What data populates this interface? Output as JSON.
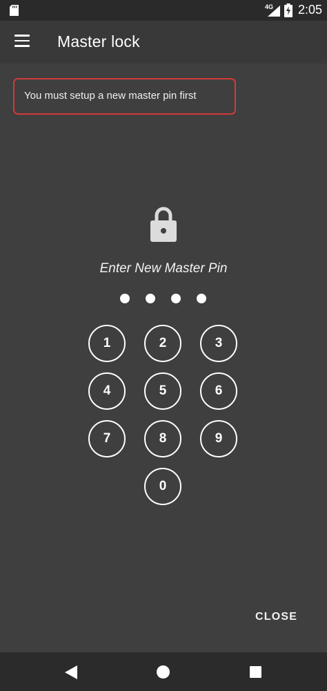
{
  "status_bar": {
    "network": "4G",
    "time": "2:05"
  },
  "app_bar": {
    "title": "Master lock"
  },
  "notice": {
    "message": "You must setup a new master pin first"
  },
  "pin": {
    "prompt": "Enter New Master Pin",
    "dots_count": 4
  },
  "keypad": {
    "keys": [
      "1",
      "2",
      "3",
      "4",
      "5",
      "6",
      "7",
      "8",
      "9",
      "0"
    ]
  },
  "actions": {
    "close_label": "CLOSE"
  },
  "colors": {
    "background": "#3f3f3f",
    "app_bar": "#393939",
    "notice_border": "#d43a3a"
  }
}
